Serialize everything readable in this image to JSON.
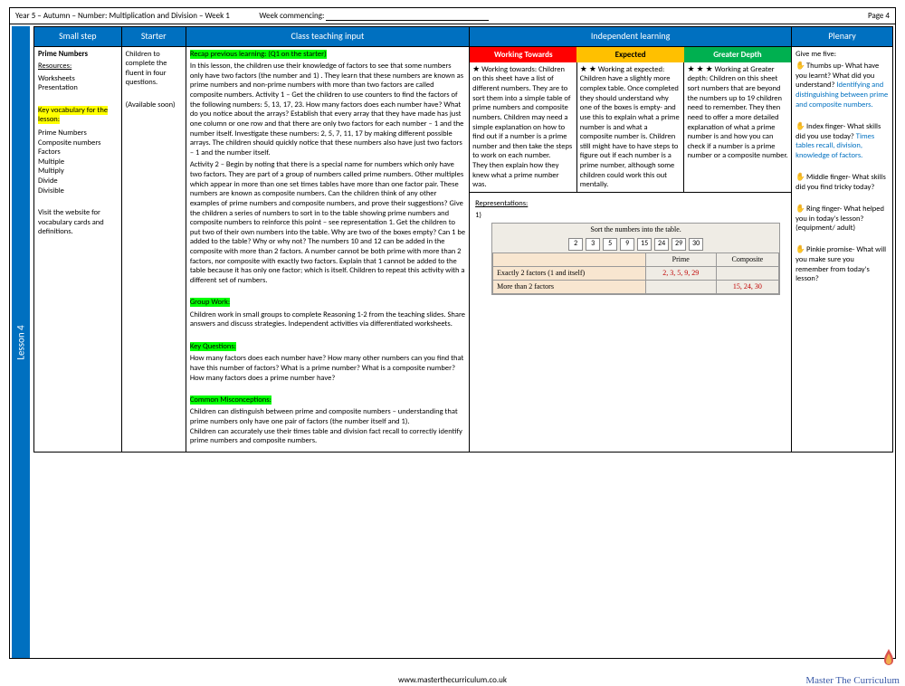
{
  "header": {
    "left": "Year 5 – Autumn – Number: Multiplication and Division – Week 1",
    "middle": "Week commencing:",
    "right": "Page 4"
  },
  "side_tab": "Lesson 4",
  "columns": {
    "c1": "Small step",
    "c2": "Starter",
    "c3": "Class teaching input",
    "c4": "Independent learning",
    "c5": "Plenary"
  },
  "smallstep": {
    "title": "Prime Numbers",
    "resources_label": "Resources:",
    "resources": "Worksheets\nPresentation",
    "vocab_label": "Key vocabulary for the lesson:",
    "vocab": "Prime Numbers\nComposite numbers\nFactors\nMultiple\nMultiply\nDivide\nDivisible",
    "note": "Visit the website for vocabulary cards and definitions."
  },
  "starter": {
    "p1": "Children to complete the fluent in four questions.",
    "p2": "(Available soon)"
  },
  "input": {
    "recap": "Recap previous learning: (Q1 on the starter)",
    "body1": "In this lesson, the children use their knowledge of factors to see that some numbers only have two factors (the number and 1) . They learn that these numbers are known as prime numbers and non-prime numbers with more than two factors are called composite numbers. Activity 1 – Get the children to use counters to find the factors of the following numbers: 5, 13, 17, 23. How many factors does each number have? What do you notice about the arrays? Establish that every array that they have made has just one column or one row and that there are only two factors for each number – 1 and the number itself. Investigate these numbers: 2, 5, 7, 11, 17 by making  different possible arrays. The children should quickly notice that these numbers also have just two factors – 1 and the number itself.",
    "body2": "Activity 2 – Begin by noting that there is a special name for numbers which only have two factors. They are part of a group of numbers called prime numbers.  Other multiples which appear in more than one set times tables  have more than one factor pair. These numbers are known as composite numbers. Can the children think of any other examples of prime numbers and composite numbers, and prove their suggestions? Give the children a series of numbers to sort in to the table showing  prime numbers and composite numbers to reinforce this point – see representation 1. Get the children to put two of their own numbers into the table. Why are two of the boxes empty? Can 1 be added to the table? Why or why not? The numbers 10 and 12 can be added in the composite with more than 2 factors. A number cannot be both prime with more than 2 factors, nor composite with exactly two factors. Explain that 1 cannot be added to the table because it has only one factor; which is itself. Children to repeat this activity with a different set of numbers.",
    "group_label": "Group Work:",
    "group": "Children work in small groups to complete Reasoning 1-2 from the teaching slides. Share answers and discuss strategies. Independent activities via differentiated worksheets.",
    "kq_label": "Key Questions:",
    "kq": "How many factors does each number have? How many other numbers can you find that have this number of factors? What is a prime number? What is a composite number? How many factors does a prime number have?",
    "cm_label": "Common Misconceptions:",
    "cm": "Children can distinguish between prime and composite numbers – understanding that prime numbers only have one pair of factors (the number itself and 1).\nChildren can accurately use their times table and division fact recall to correctly identify prime numbers and composite numbers."
  },
  "indep": {
    "wt_label": "Working Towards",
    "ex_label": "Expected",
    "gd_label": "Greater Depth",
    "wt_stars": "★",
    "ex_stars": "★ ★",
    "gd_stars": "★ ★ ★",
    "wt_head": "Working towards:",
    "ex_head": "Working at expected:",
    "gd_head": "Working at Greater depth:",
    "wt_body": "Children on this sheet have a list of different numbers. They are to sort them into a simple table of prime numbers and composite numbers. Children may need a simple explanation on how to find out if a number is a prime number and then take the steps to work on each number.\nThey then explain how they knew what a prime number was.",
    "ex_body": "Children have a slightly more complex table. Once completed they should understand why one of the boxes is empty- and use this to explain what a prime number is and what a composite number is. Children still might have to have steps to figure out if each number is a prime number, although some children could work this out mentally.",
    "gd_body": "Children on this sheet sort numbers that are beyond the numbers up to 19 children need to remember. They then need to offer a more detailed explanation of what a prime number is and how you can check if a number is a prime number or a composite number.",
    "rep_label": "Representations:",
    "rep_num": "1)",
    "sort_title": "Sort the numbers into the table.",
    "nums": [
      "2",
      "3",
      "5",
      "9",
      "15",
      "24",
      "29",
      "30"
    ],
    "blank": "",
    "prime": "Prime",
    "composite": "Composite",
    "row1_label": "Exactly 2 factors (1 and itself)",
    "row1_prime": "2, 3, 5, 9, 29",
    "row2_label": "More than 2 factors",
    "row2_comp": "15, 24, 30"
  },
  "plenary": {
    "intro": "Give me five:",
    "thumbs": "Thumbs up- What have you learnt? What did you understand?",
    "thumbs_blue": "Identifying and distinguishing between prime and composite numbers.",
    "index": "Index finger- What skills did you use today?",
    "index_blue": "Times tables recall, division, knowledge of factors.",
    "middle": "Middle finger- What skills did you find tricky today?",
    "ring": "Ring finger- What helped you in today's lesson? (equipment/ adult)",
    "pinkie": "Pinkie promise- What will you make sure you remember from today's lesson?"
  },
  "footer": {
    "url": "www.masterthecurriculum.co.uk",
    "brand": "Master The Curriculum"
  }
}
